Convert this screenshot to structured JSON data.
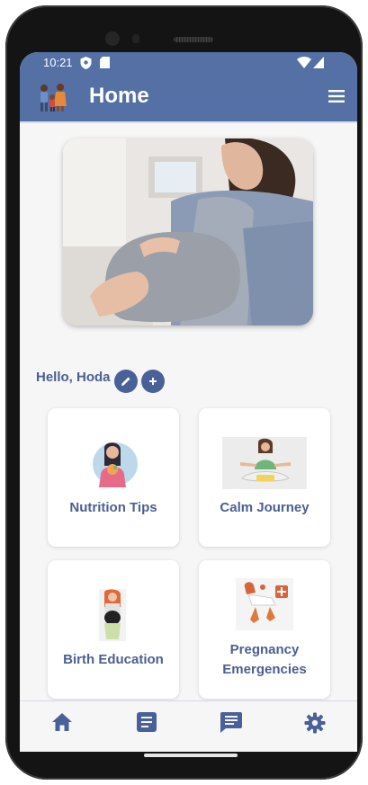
{
  "status_bar": {
    "time": "10:21"
  },
  "app_bar": {
    "title": "Home"
  },
  "greeting": "Hello, Hoda",
  "cards": [
    {
      "label": "Nutrition Tips"
    },
    {
      "label": "Calm Journey"
    },
    {
      "label": "Birth Education"
    },
    {
      "label": "Pregnancy Emergencies"
    }
  ],
  "bottom_nav": [
    "home-icon",
    "article-icon",
    "chat-icon",
    "settings-icon"
  ],
  "colors": {
    "primary": "#5470a5",
    "text": "#4b5f92",
    "background": "#f6f6f6"
  }
}
